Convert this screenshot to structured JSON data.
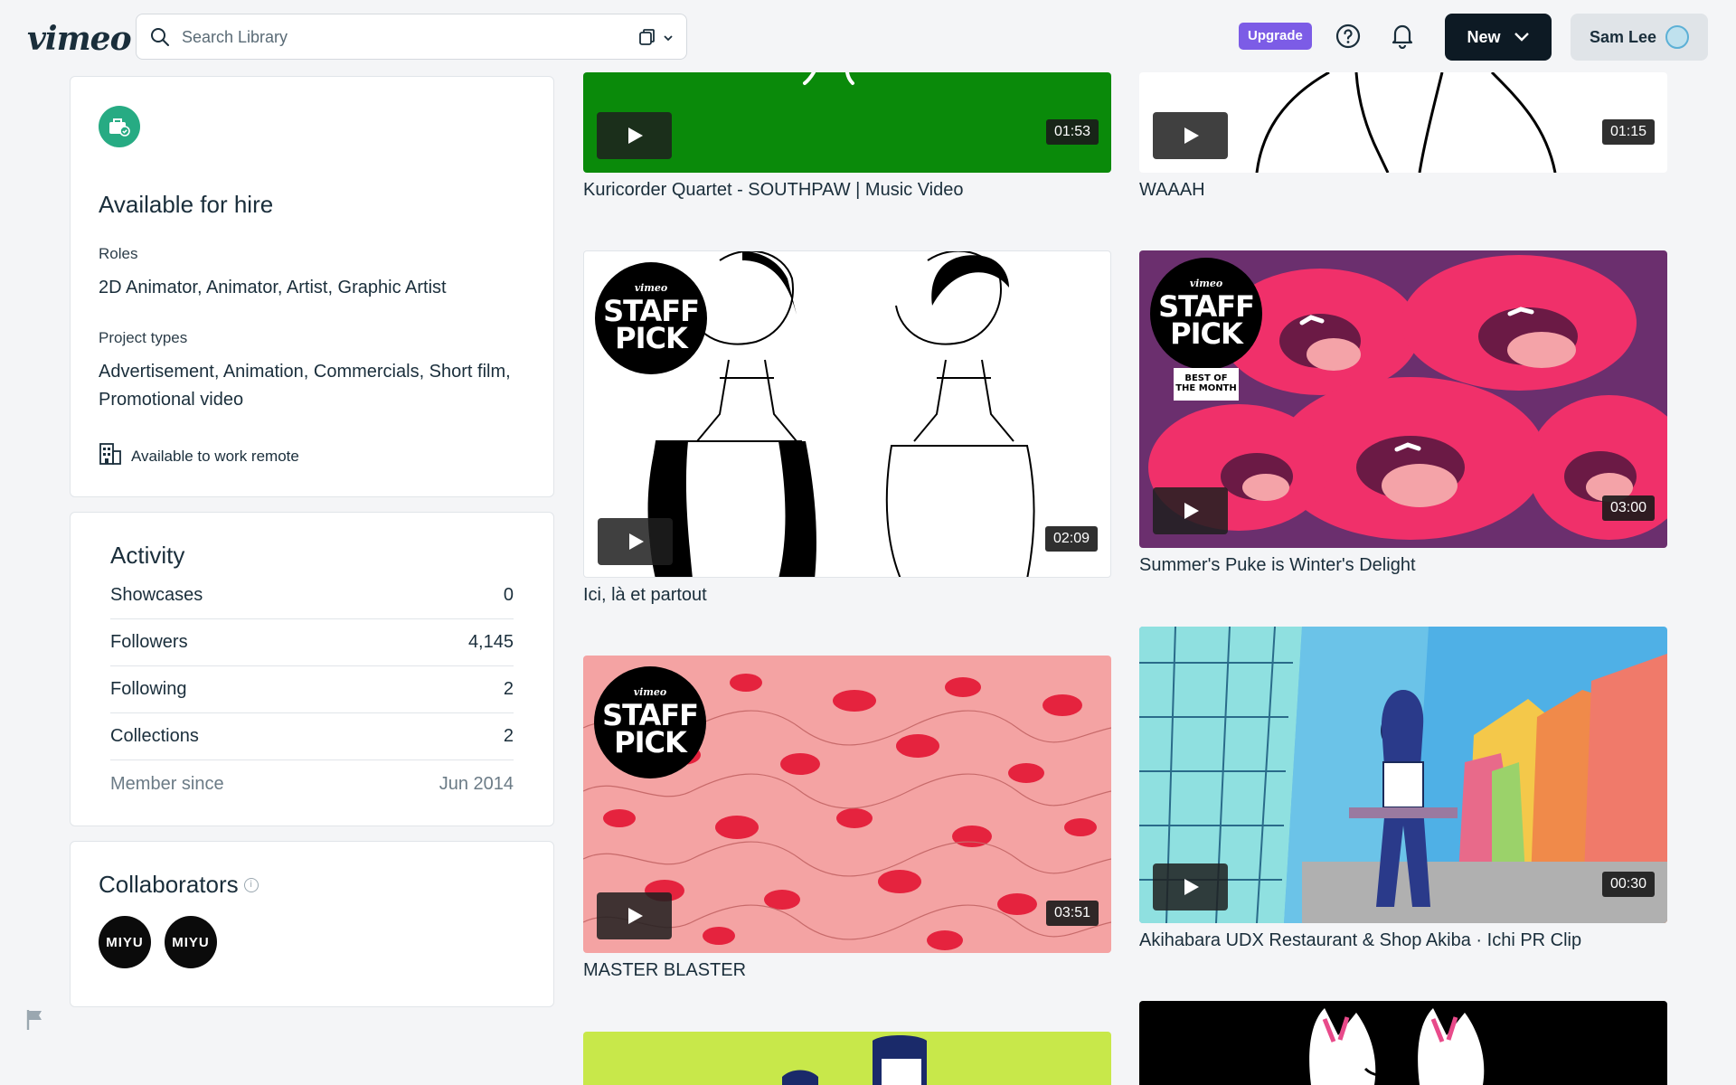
{
  "header": {
    "logo": "vimeo",
    "search_placeholder": "Search Library",
    "upgrade": "Upgrade",
    "new_label": "New",
    "user_name": "Sam Lee"
  },
  "hire": {
    "title": "Available for hire",
    "roles_label": "Roles",
    "roles": "2D Animator, Animator, Artist, Graphic Artist",
    "project_types_label": "Project types",
    "project_types": "Advertisement, Animation, Commercials, Short film, Promotional video",
    "remote": "Available to work remote"
  },
  "activity": {
    "title": "Activity",
    "rows": [
      {
        "label": "Showcases",
        "value": "0"
      },
      {
        "label": "Followers",
        "value": "4,145"
      },
      {
        "label": "Following",
        "value": "2"
      },
      {
        "label": "Collections",
        "value": "2"
      },
      {
        "label": "Member since",
        "value": "Jun 2014"
      }
    ]
  },
  "collaborators": {
    "title": "Collaborators",
    "items": [
      "MIYU",
      "MIYU"
    ]
  },
  "staff_pick": {
    "brand": "vimeo",
    "line1": "STAFF",
    "line2": "PICK",
    "best_of_month": "BEST OF THE MONTH"
  },
  "videos": [
    {
      "title": "Kuricorder Quartet - SOUTHPAW | Music Video",
      "duration": "01:53"
    },
    {
      "title": "WAAAH",
      "duration": "01:15"
    },
    {
      "title": "Ici, là et partout",
      "duration": "02:09"
    },
    {
      "title": "Summer's Puke is Winter's Delight",
      "duration": "03:00"
    },
    {
      "title": "MASTER BLASTER",
      "duration": "03:51"
    },
    {
      "title": "Akihabara UDX Restaurant & Shop Akiba · Ichi PR Clip",
      "duration": "00:30"
    }
  ]
}
